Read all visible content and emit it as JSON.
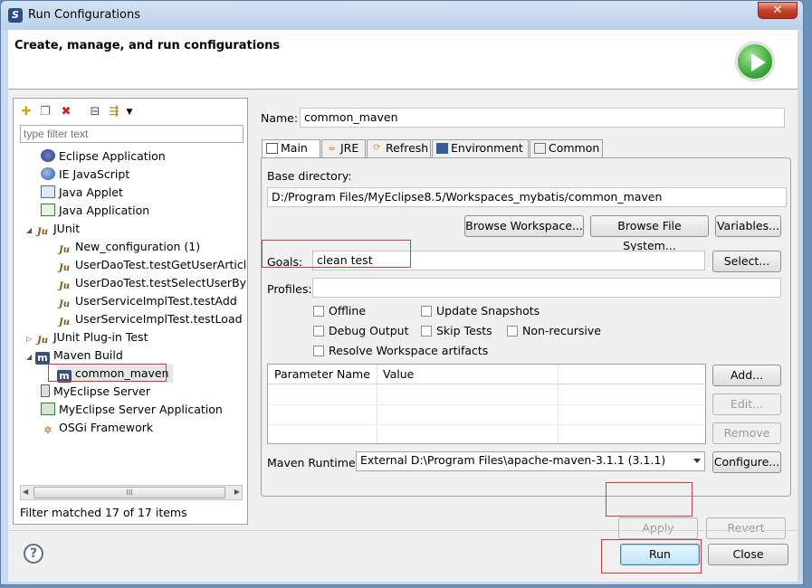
{
  "window": {
    "title": "Run Configurations",
    "close_label": "✕"
  },
  "banner": {
    "title": "Create, manage, and run configurations"
  },
  "left": {
    "filter_placeholder": "type filter text",
    "tree": [
      {
        "label": "Eclipse Application",
        "icon": "eclipse-icon",
        "level": 0
      },
      {
        "label": "IE JavaScript",
        "icon": "globe-icon",
        "level": 0
      },
      {
        "label": "Java Applet",
        "icon": "applet-icon",
        "level": 0
      },
      {
        "label": "Java Application",
        "icon": "java-app-icon",
        "level": 0
      },
      {
        "label": "JUnit",
        "icon": "junit-icon",
        "level": 0,
        "expanded": true
      },
      {
        "label": "New_configuration (1)",
        "icon": "junit-icon",
        "level": 1
      },
      {
        "label": "UserDaoTest.testGetUserArticles",
        "icon": "junit-icon",
        "level": 1
      },
      {
        "label": "UserDaoTest.testSelectUserByID",
        "icon": "junit-icon",
        "level": 1
      },
      {
        "label": "UserServiceImplTest.testAdd",
        "icon": "junit-icon",
        "level": 1
      },
      {
        "label": "UserServiceImplTest.testLoad",
        "icon": "junit-icon",
        "level": 1
      },
      {
        "label": "JUnit Plug-in Test",
        "icon": "junit-plugin-icon",
        "level": 0,
        "collapsed": true
      },
      {
        "label": "Maven Build",
        "icon": "maven-icon",
        "level": 0,
        "expanded": true
      },
      {
        "label": "common_maven",
        "icon": "maven-icon",
        "level": 1,
        "selected": true
      },
      {
        "label": "MyEclipse Server",
        "icon": "server-icon",
        "level": 0
      },
      {
        "label": "MyEclipse Server Application",
        "icon": "server-app-icon",
        "level": 0
      },
      {
        "label": "OSGi Framework",
        "icon": "osgi-icon",
        "level": 0
      }
    ],
    "status": "Filter matched 17 of 17 items"
  },
  "right": {
    "name_label": "Name:",
    "name_value": "common_maven",
    "tabs": [
      {
        "label": "Main",
        "active": true
      },
      {
        "label": "JRE"
      },
      {
        "label": "Refresh"
      },
      {
        "label": "Environment"
      },
      {
        "label": "Common"
      }
    ],
    "base_dir_label": "Base directory:",
    "base_dir_value": "D:/Program Files/MyEclipse8.5/Workspaces_mybatis/common_maven",
    "browse_workspace": "Browse Workspace...",
    "browse_fs": "Browse File System...",
    "variables": "Variables...",
    "goals_label": "Goals:",
    "goals_value": "clean test",
    "select": "Select...",
    "profiles_label": "Profiles:",
    "checks": {
      "offline": "Offline",
      "update_snapshots": "Update Snapshots",
      "debug_output": "Debug Output",
      "skip_tests": "Skip Tests",
      "non_recursive": "Non-recursive",
      "resolve_ws": "Resolve Workspace artifacts"
    },
    "params": {
      "col1": "Parameter Name",
      "col2": "Value"
    },
    "add": "Add...",
    "edit": "Edit...",
    "remove": "Remove",
    "runtime_label": "Maven Runtime:",
    "runtime_value": "External D:\\Program Files\\apache-maven-3.1.1 (3.1.1)",
    "configure": "Configure...",
    "apply": "Apply",
    "revert": "Revert"
  },
  "footer": {
    "help": "?",
    "run": "Run",
    "close": "Close"
  },
  "scroll_mark": "III"
}
